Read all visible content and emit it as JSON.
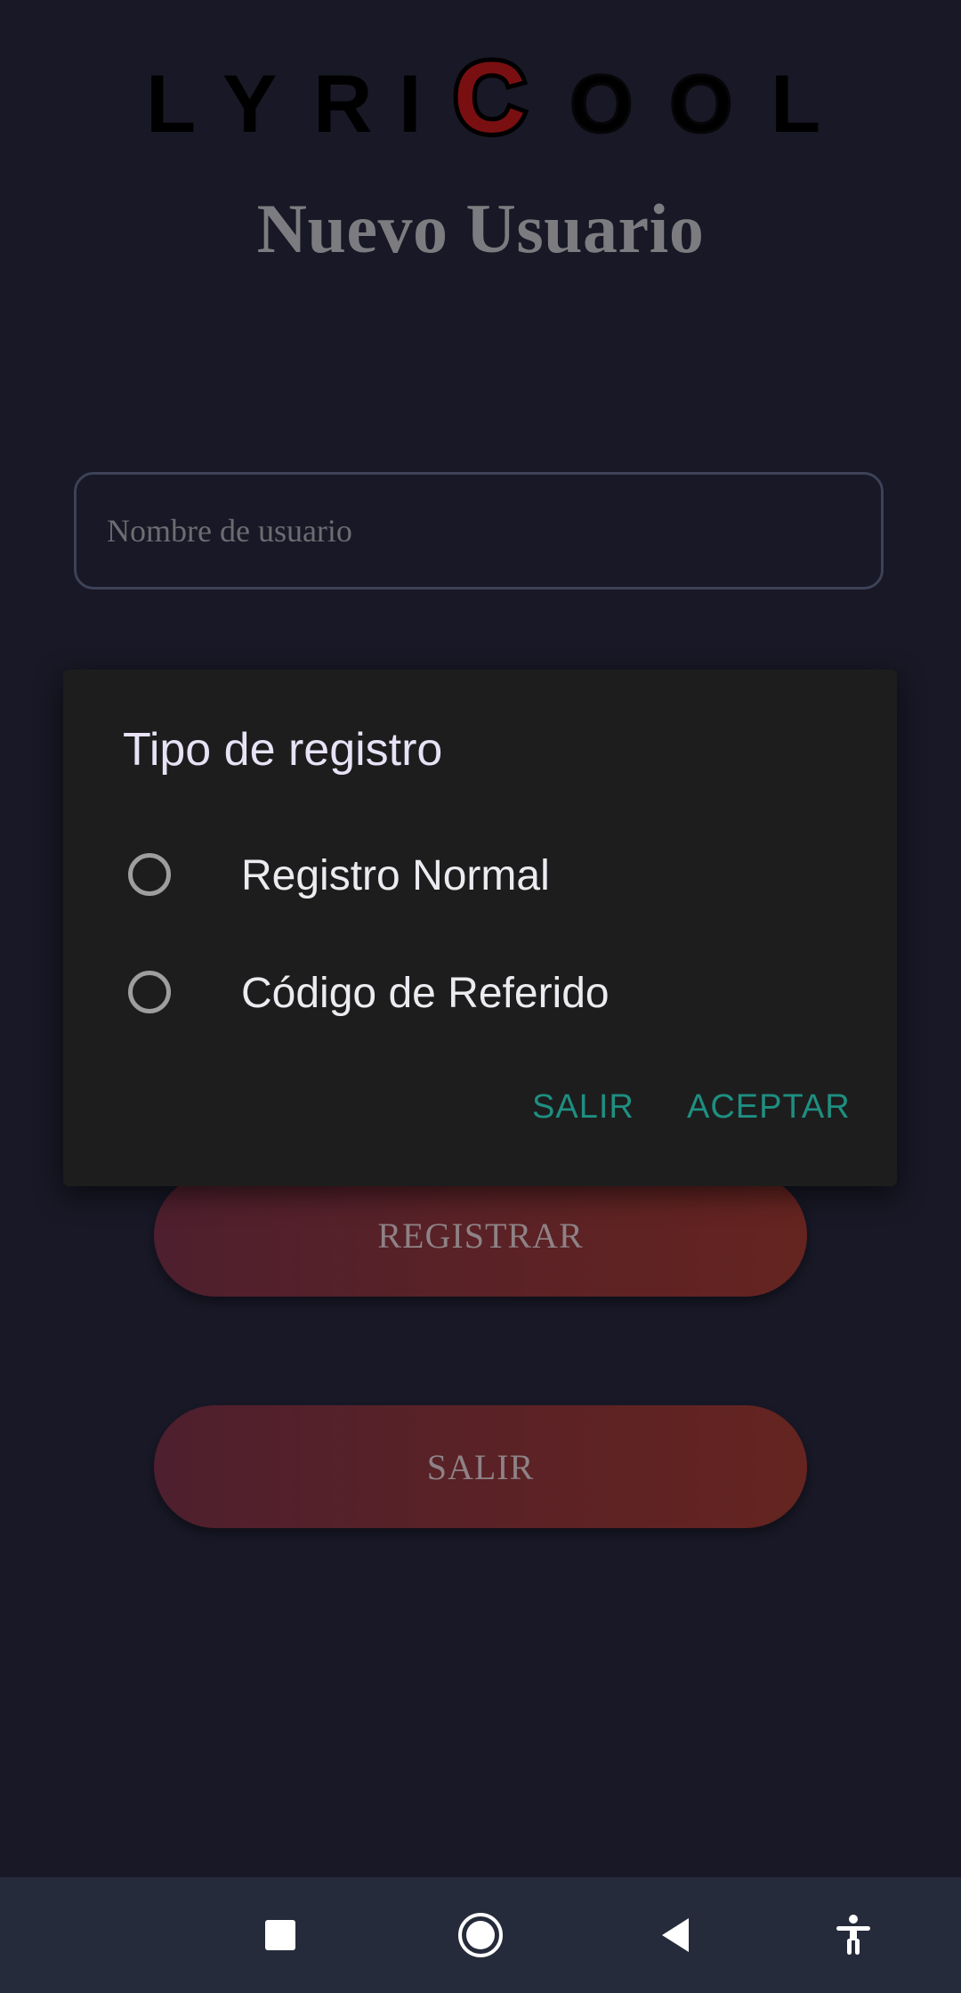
{
  "logo": {
    "letters": [
      "L",
      "Y",
      "R",
      "I",
      "C",
      "O",
      "O",
      "L"
    ],
    "accent_color": "#7a0f12"
  },
  "page": {
    "title": "Nuevo Usuario"
  },
  "username": {
    "placeholder": "Nombre de usuario",
    "value": ""
  },
  "buttons": {
    "register_label": "REGISTRAR",
    "exit_label": "SALIR"
  },
  "dialog": {
    "title": "Tipo de registro",
    "options": [
      {
        "label": "Registro Normal",
        "selected": false
      },
      {
        "label": "Código de Referido",
        "selected": false
      }
    ],
    "cancel_label": "SALIR",
    "accept_label": "ACEPTAR",
    "action_color": "#1e8f81"
  },
  "navbar": {
    "icons": [
      "recent-apps-icon",
      "home-icon",
      "back-icon",
      "accessibility-icon"
    ]
  },
  "colors": {
    "background": "#181826",
    "dialog_bg": "#1d1d1d",
    "navbar_bg": "#262b3b"
  }
}
